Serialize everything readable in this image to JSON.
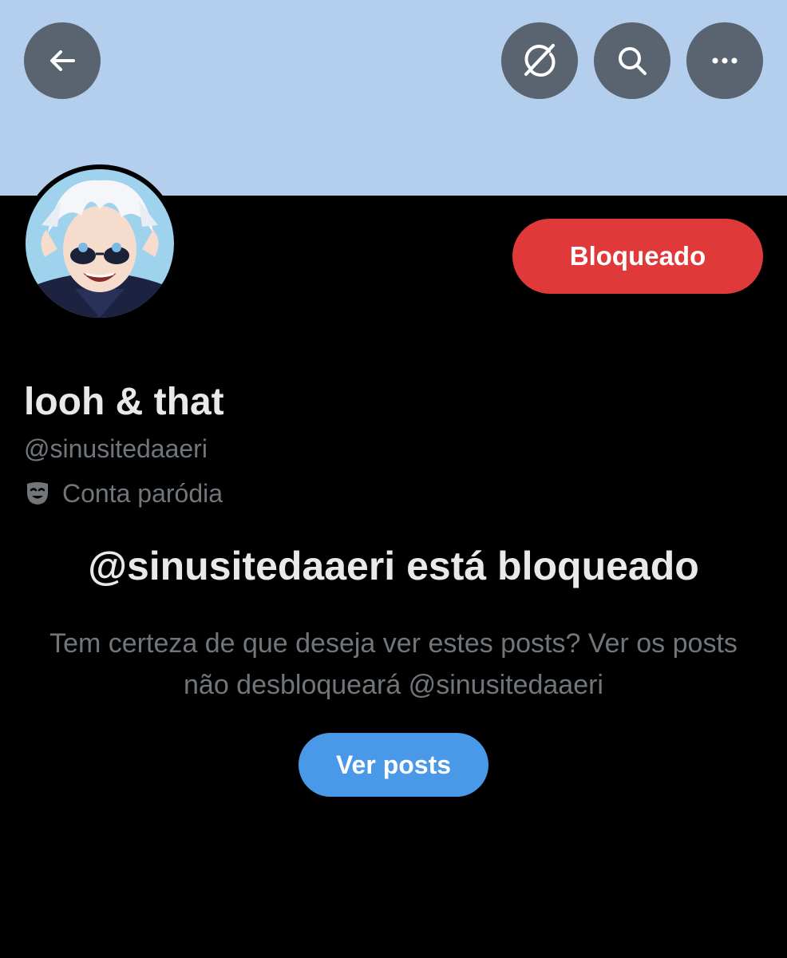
{
  "header": {
    "back_icon": "arrow-left-icon",
    "grok_icon": "grok-icon",
    "search_icon": "search-icon",
    "more_icon": "more-horizontal-icon",
    "banner_color": "#b4cfee"
  },
  "profile": {
    "display_name": "looh & that",
    "handle": "@sinusitedaaeri",
    "label_icon": "mask-icon",
    "label": "Conta paródia",
    "block_button_label": "Bloqueado",
    "block_button_color": "#e0393a"
  },
  "blocked_notice": {
    "title": "@sinusitedaaeri está bloqueado",
    "description": "Tem certeza de que deseja ver estes posts? Ver os posts não desbloqueará @sinusitedaaeri",
    "view_button_label": "Ver posts",
    "view_button_color": "#4a99e9"
  }
}
